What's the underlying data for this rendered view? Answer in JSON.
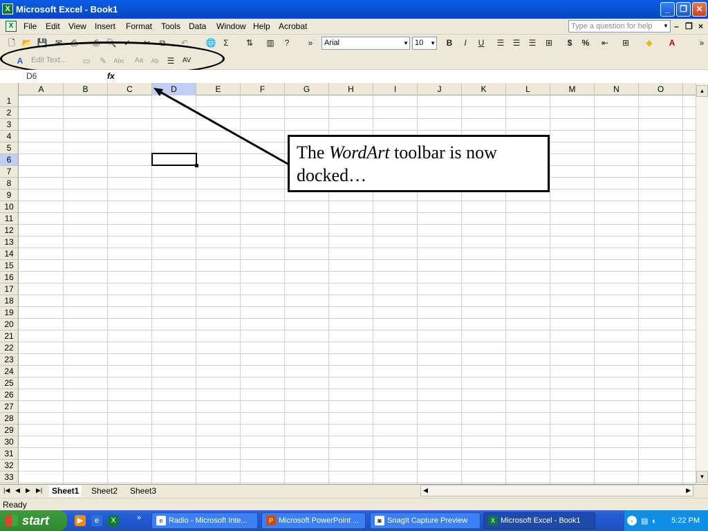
{
  "window": {
    "title": "Microsoft Excel - Book1",
    "min": "_",
    "max": "❐",
    "close": "✕"
  },
  "menu": {
    "items": [
      "File",
      "Edit",
      "View",
      "Insert",
      "Format",
      "Tools",
      "Data",
      "Window",
      "Help",
      "Acrobat"
    ],
    "help_placeholder": "Type a question for help"
  },
  "formatting": {
    "font": "Arial",
    "size": "10"
  },
  "wordart_toolbar": {
    "edit_text": "Edit Text..."
  },
  "namebox": "D6",
  "fx": "fx",
  "columns": [
    "A",
    "B",
    "C",
    "D",
    "E",
    "F",
    "G",
    "H",
    "I",
    "J",
    "K",
    "L",
    "M",
    "N",
    "O"
  ],
  "rows": [
    "1",
    "2",
    "3",
    "4",
    "5",
    "6",
    "7",
    "8",
    "9",
    "10",
    "11",
    "12",
    "13",
    "14",
    "15",
    "16",
    "17",
    "18",
    "19",
    "20",
    "21",
    "22",
    "23",
    "24",
    "25",
    "26",
    "27",
    "28",
    "29",
    "30",
    "31",
    "32",
    "33"
  ],
  "selected_cell": {
    "column": "D",
    "row": "6"
  },
  "sheets": [
    "Sheet1",
    "Sheet2",
    "Sheet3"
  ],
  "status": "Ready",
  "callout": {
    "pre": "The ",
    "emph": "WordArt",
    "post": " toolbar is now docked…"
  },
  "taskbar": {
    "start": "start",
    "tasks": [
      "Radio - Microsoft Inte...",
      "Microsoft PowerPoint ...",
      "SnagIt Capture Preview",
      "Microsoft Excel - Book1"
    ],
    "clock": "5:22 PM"
  }
}
